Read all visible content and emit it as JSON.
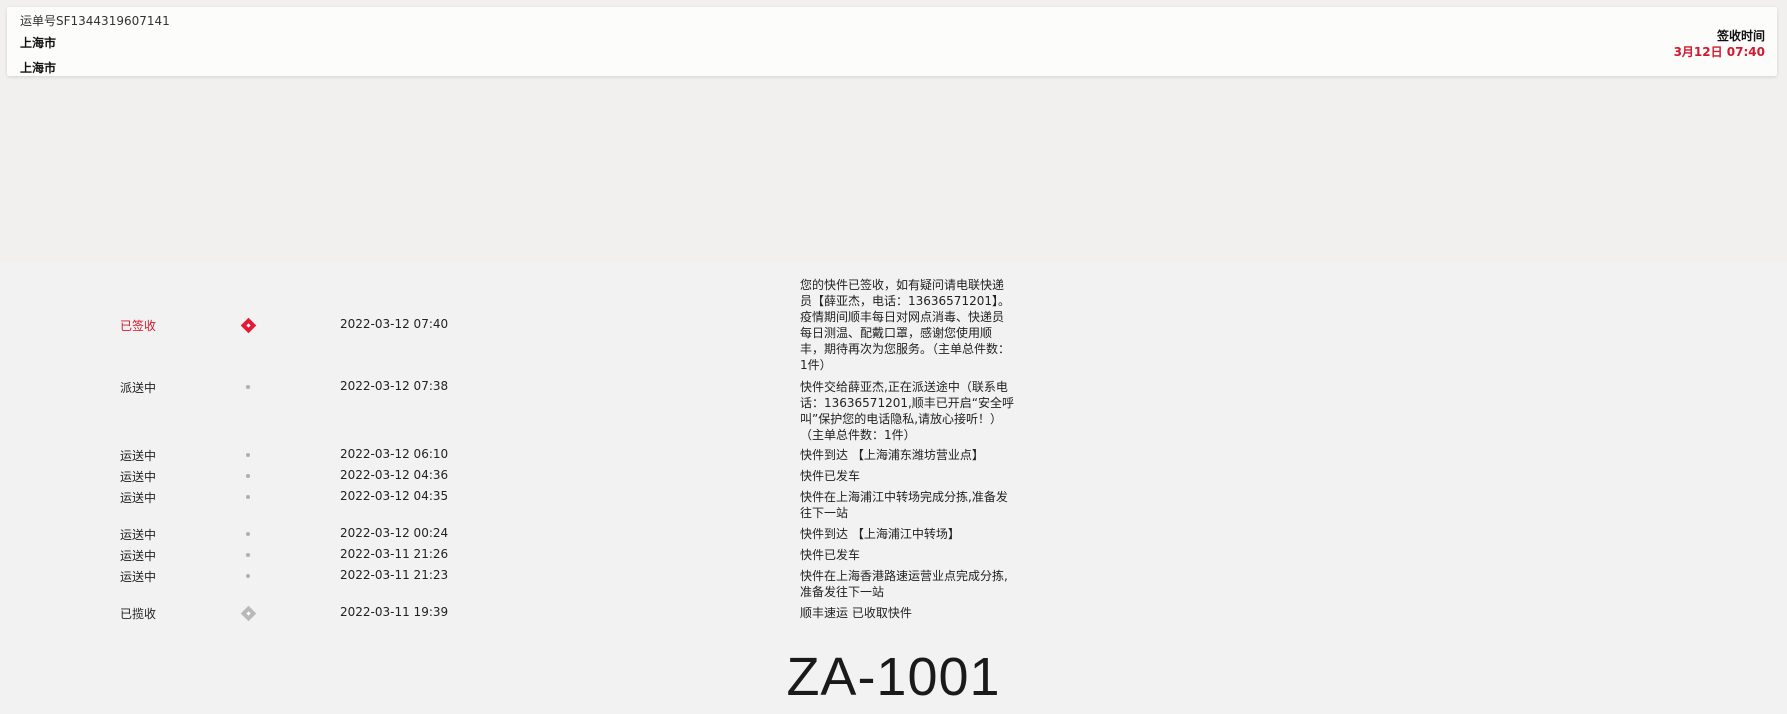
{
  "header": {
    "waybill": "运单号SF1344319607141",
    "from_city": "上海市",
    "to_city": "上海市",
    "sign_label": "签收时间",
    "sign_time": "3月12日 07:40"
  },
  "events": [
    {
      "status": "已签收",
      "marker": "diamond-red",
      "time": "2022-03-12 07:40",
      "desc": "您的快件已签收，如有疑问请电联快递员【薛亚杰，电话：13636571201】。疫情期间顺丰每日对网点消毒、快递员每日测温、配戴口罩，感谢您使用顺丰，期待再次为您服务。（主单总件数：1件）"
    },
    {
      "status": "派送中",
      "marker": "dot",
      "time": "2022-03-12 07:38",
      "desc": "快件交给薛亚杰,正在派送途中（联系电话：13636571201,顺丰已开启“安全呼叫”保护您的电话隐私,请放心接听！）（主单总件数：1件）"
    },
    {
      "status": "运送中",
      "marker": "dot",
      "time": "2022-03-12 06:10",
      "desc": "快件到达 【上海浦东潍坊营业点】"
    },
    {
      "status": "运送中",
      "marker": "dot",
      "time": "2022-03-12 04:36",
      "desc": "快件已发车"
    },
    {
      "status": "运送中",
      "marker": "dot",
      "time": "2022-03-12 04:35",
      "desc": "快件在上海浦江中转场完成分拣,准备发往下一站"
    },
    {
      "status": "运送中",
      "marker": "dot",
      "time": "2022-03-12 00:24",
      "desc": "快件到达 【上海浦江中转场】"
    },
    {
      "status": "运送中",
      "marker": "dot",
      "time": "2022-03-11 21:26",
      "desc": "快件已发车"
    },
    {
      "status": "运送中",
      "marker": "dot",
      "time": "2022-03-11 21:23",
      "desc": "快件在上海香港路速运营业点完成分拣,准备发往下一站"
    },
    {
      "status": "已揽收",
      "marker": "diamond-grey",
      "time": "2022-03-11 19:39",
      "desc": "顺丰速运 已收取快件"
    }
  ],
  "watermark": "ZA-1001",
  "colors": {
    "accent": "#d2192f",
    "dot": "#b0b0b0"
  }
}
